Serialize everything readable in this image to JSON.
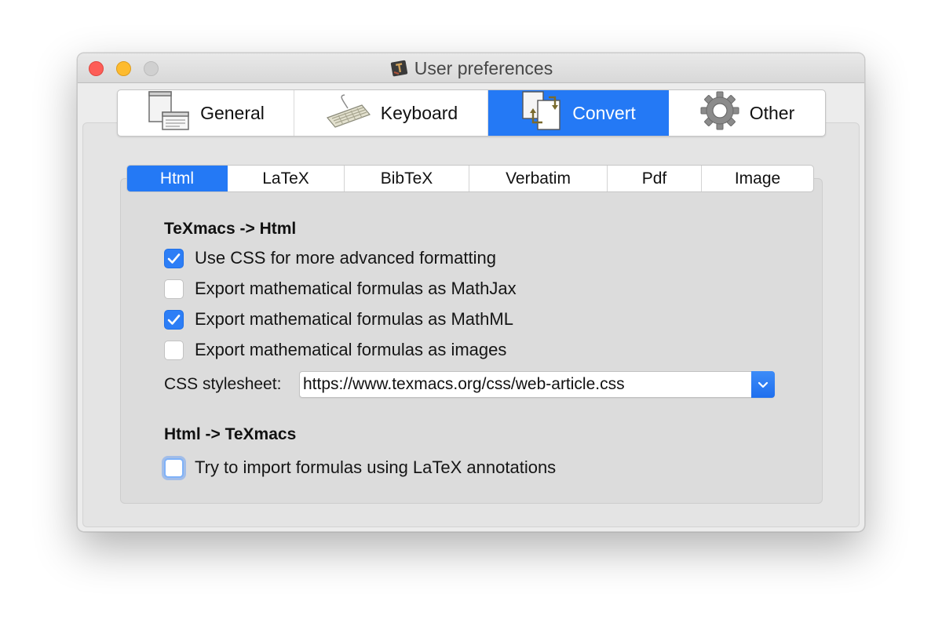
{
  "window": {
    "title": "User preferences"
  },
  "main_tabs": [
    {
      "label": "General",
      "icon": "window-layout-icon"
    },
    {
      "label": "Keyboard",
      "icon": "keyboard-icon"
    },
    {
      "label": "Convert",
      "icon": "convert-document-icon",
      "active": true
    },
    {
      "label": "Other",
      "icon": "gear-icon"
    }
  ],
  "sub_tabs": [
    {
      "label": "Html",
      "active": true
    },
    {
      "label": "LaTeX"
    },
    {
      "label": "BibTeX"
    },
    {
      "label": "Verbatim"
    },
    {
      "label": "Pdf"
    },
    {
      "label": "Image"
    }
  ],
  "html_export": {
    "section_title": "TeXmacs -> Html",
    "options": [
      {
        "label": "Use CSS for more advanced formatting",
        "checked": true
      },
      {
        "label": "Export mathematical formulas as MathJax",
        "checked": false
      },
      {
        "label": "Export mathematical formulas as MathML",
        "checked": true
      },
      {
        "label": "Export mathematical formulas as images",
        "checked": false
      }
    ],
    "css_label": "CSS stylesheet:",
    "css_value": "https://www.texmacs.org/css/web-article.css"
  },
  "html_import": {
    "section_title": "Html -> TeXmacs",
    "options": [
      {
        "label": "Try to import formulas using LaTeX annotations",
        "checked": false,
        "focused": true
      }
    ]
  },
  "colors": {
    "accent": "#2479f5",
    "close": "#fd5d57",
    "minimize": "#fdbb2f",
    "zoom_disabled": "#d0d0d0"
  }
}
